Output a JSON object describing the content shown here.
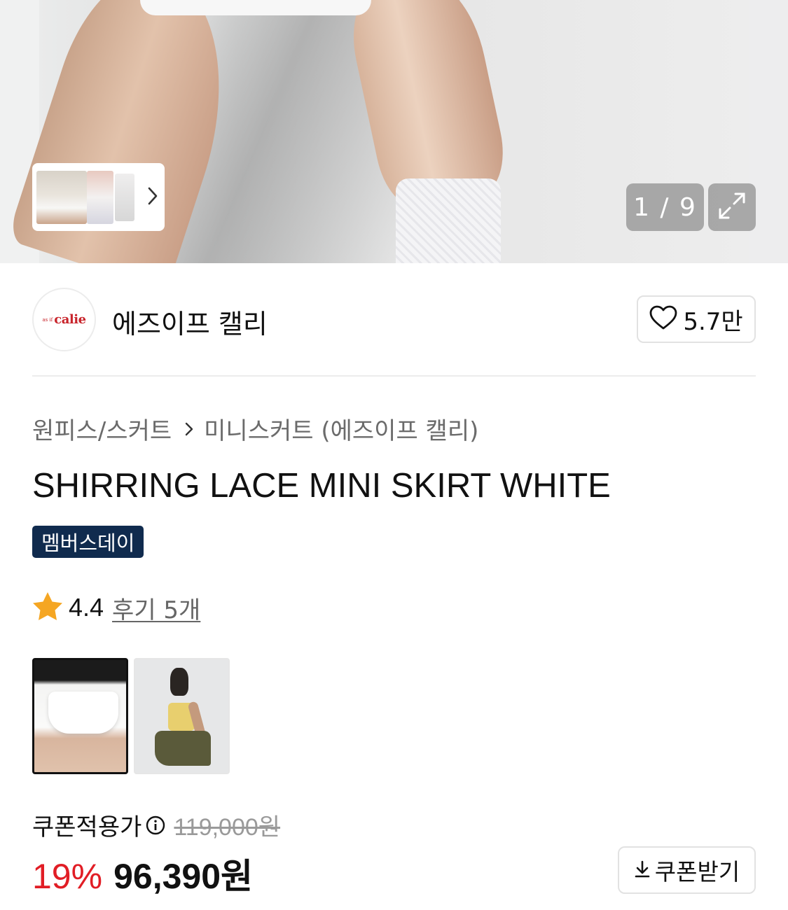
{
  "gallery": {
    "counter": "1 / 9"
  },
  "brand": {
    "logo_text": "calie",
    "logo_small": "as if",
    "name": "에즈이프 캘리",
    "like_count": "5.7만"
  },
  "breadcrumb": {
    "category": "원피스/스커트",
    "subcategory": "미니스커트 (에즈이프 캘리)"
  },
  "product": {
    "title": "SHIRRING LACE MINI SKIRT WHITE",
    "badge": "멤버스데이",
    "rating": "4.4",
    "reviews": "후기 5개"
  },
  "price": {
    "label": "쿠폰적용가",
    "original": "119,000원",
    "discount": "19%",
    "final": "96,390원",
    "coupon_button": "쿠폰받기"
  },
  "colors": {
    "badge_bg": "#102b4e",
    "discount": "#e11d25",
    "star": "#f5a623"
  }
}
